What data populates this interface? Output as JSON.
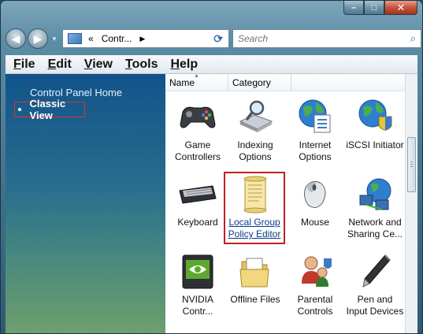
{
  "titlebar": {
    "minimize_glyph": "–",
    "maximize_glyph": "□",
    "close_glyph": "✕"
  },
  "navbar": {
    "back_glyph": "◀",
    "forward_glyph": "▶",
    "address_chevron": "«",
    "address_text": "Contr...",
    "address_arrow": "▶",
    "address_dropdown": "▼",
    "refresh_glyph": "⟳",
    "search_placeholder": "Search",
    "search_glyph": "⌕"
  },
  "menubar": {
    "items": [
      {
        "key": "F",
        "rest": "ile"
      },
      {
        "key": "E",
        "rest": "dit"
      },
      {
        "key": "V",
        "rest": "iew"
      },
      {
        "key": "T",
        "rest": "ools"
      },
      {
        "key": "H",
        "rest": "elp"
      }
    ]
  },
  "sidebar": {
    "home_label": "Control Panel Home",
    "classic_label": "Classic View"
  },
  "columns": {
    "name": "Name",
    "category": "Category",
    "sort_glyph": "▲"
  },
  "items": [
    {
      "line1": "Game",
      "line2": "Controllers",
      "icon": "gamepad-icon"
    },
    {
      "line1": "Indexing",
      "line2": "Options",
      "icon": "indexing-icon"
    },
    {
      "line1": "Internet",
      "line2": "Options",
      "icon": "globe-icon"
    },
    {
      "line1": "iSCSI Initiator",
      "line2": "",
      "icon": "iscsi-icon"
    },
    {
      "line1": "Keyboard",
      "line2": "",
      "icon": "keyboard-icon"
    },
    {
      "line1": "Local Group",
      "line2": "Policy Editor",
      "icon": "scroll-icon"
    },
    {
      "line1": "Mouse",
      "line2": "",
      "icon": "mouse-icon"
    },
    {
      "line1": "Network and",
      "line2": "Sharing Ce...",
      "icon": "network-icon"
    },
    {
      "line1": "NVIDIA",
      "line2": "Contr...",
      "icon": "nvidia-icon"
    },
    {
      "line1": "Offline Files",
      "line2": "",
      "icon": "folder-icon"
    },
    {
      "line1": "Parental",
      "line2": "Controls",
      "icon": "parental-icon"
    },
    {
      "line1": "Pen and",
      "line2": "Input Devices",
      "icon": "pen-icon"
    }
  ]
}
